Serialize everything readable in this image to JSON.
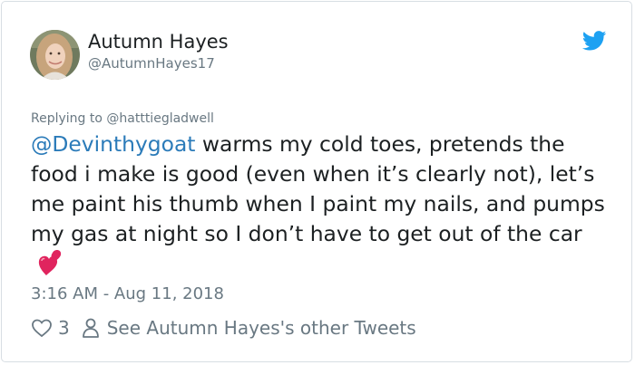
{
  "author": {
    "display_name": "Autumn Hayes",
    "handle": "@AutumnHayes17"
  },
  "icons": {
    "brand": "twitter-bird-icon",
    "like": "heart-outline-icon",
    "profile": "person-icon",
    "emoji": "two-hearts-emoji"
  },
  "colors": {
    "text": "#1c2022",
    "muted": "#697882",
    "link": "#2b7bb9",
    "twitter_blue": "#1da1f2",
    "emoji_heart": "#e0245e"
  },
  "tweet": {
    "replying_prefix": "Replying to",
    "replying_to": "@hatttiegladwell",
    "mention": "@Devinthygoat",
    "body": " warms my cold toes, pretends the food i make is good (even when it’s clearly not), let’s me paint his thumb when I paint my nails, and pumps my gas at night so I don’t have to get out of the car",
    "timestamp": "3:16 AM - Aug 11, 2018"
  },
  "actions": {
    "like_count": "3",
    "other_tweets_label": "See Autumn Hayes's other Tweets"
  }
}
